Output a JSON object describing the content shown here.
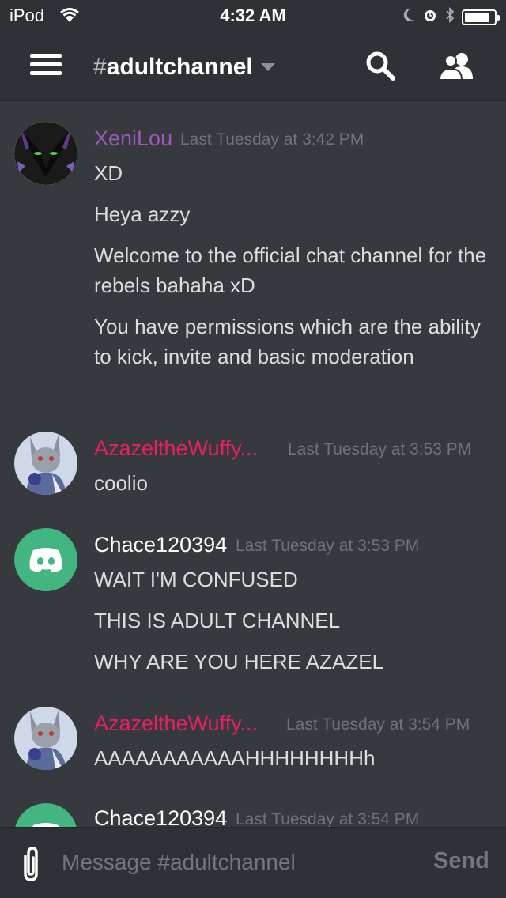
{
  "status_bar": {
    "carrier": "iPod",
    "time": "4:32 AM",
    "battery_level": 0.85
  },
  "header": {
    "hash": "#",
    "channel_name": "adultchannel"
  },
  "colors": {
    "purple_user": "#9b59b6",
    "red_user": "#e91e63",
    "white_user": "#ffffff",
    "discord_green": "#43b581"
  },
  "messages": [
    {
      "username": "XeniLou",
      "timestamp": "Last Tuesday at 3:42 PM",
      "avatar_icon": "wolf-avatar",
      "lines": [
        "XD",
        "Heya azzy",
        "Welcome to the official chat channel for the rebels bahaha xD",
        "You have permissions which are the ability to kick, invite and basic moderation"
      ]
    },
    {
      "username": "AzazeltheWuffy...",
      "timestamp": "Last Tuesday at 3:53 PM",
      "avatar_icon": "wolf-character-avatar",
      "lines": [
        "coolio"
      ]
    },
    {
      "username": "Chace120394",
      "timestamp": "Last Tuesday at 3:53 PM",
      "avatar_icon": "discord-default-avatar",
      "lines": [
        "WAIT I'M CONFUSED",
        "THIS IS ADULT CHANNEL",
        "WHY ARE YOU HERE AZAZEL"
      ]
    },
    {
      "username": "AzazeltheWuffy...",
      "timestamp": "Last Tuesday at 3:54 PM",
      "avatar_icon": "wolf-character-avatar",
      "lines": [
        "AAAAAAAAAAAHHHHHHHHh"
      ]
    },
    {
      "username": "Chace120394",
      "timestamp": "Last Tuesday at 3:54 PM",
      "avatar_icon": "discord-default-avatar",
      "lines": []
    }
  ],
  "composer": {
    "placeholder": "Message #adultchannel",
    "send_label": "Send"
  }
}
